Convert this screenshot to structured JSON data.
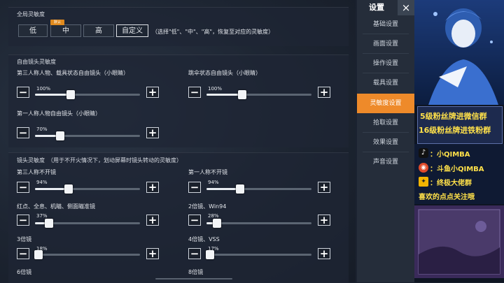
{
  "sensitivity": {
    "title": "全局灵敏度",
    "options": [
      "低",
      "中",
      "高",
      "自定义"
    ],
    "default_tag": "默认",
    "active_option": "自定义",
    "hint": "（选择\"低\"、\"中\"、\"高\"，恢复至对应的灵敏度）"
  },
  "free_camera": {
    "title": "自由镜头灵敏度",
    "sliders": [
      {
        "label": "第三人称人物、载具状态自由镜头（小眼睛）",
        "percent": "100%",
        "value": 100
      },
      {
        "label": "跳伞状态自由镜头（小眼睛）",
        "percent": "100%",
        "value": 100
      },
      {
        "label": "第一人称人物自由镜头（小眼睛）",
        "percent": "70%",
        "value": 70
      }
    ]
  },
  "lens": {
    "title": "镜头灵敏度　（用于不开火情况下，划动屏幕时镜头转动的灵敏度）",
    "sliders": [
      {
        "label": "第三人称不开镜",
        "percent": "94%",
        "value": 94
      },
      {
        "label": "第一人称不开镜",
        "percent": "94%",
        "value": 94
      },
      {
        "label": "红点、全息、机瞄、侧面瞄准镜",
        "percent": "37%",
        "value": 37
      },
      {
        "label": "2倍镜、Win94",
        "percent": "28%",
        "value": 28
      },
      {
        "label": "3倍镜",
        "percent": "18%",
        "value": 18
      },
      {
        "label": "4倍镜、VSS",
        "percent": "17%",
        "value": 17
      }
    ],
    "more_labels": [
      "6倍镜",
      "8倍镜"
    ]
  },
  "sidebar": {
    "title": "设置",
    "close": "×",
    "items": [
      "基础设置",
      "画面设置",
      "操作设置",
      "载具设置",
      "灵敏度设置",
      "拾取设置",
      "效果设置",
      "声音设置"
    ],
    "active_index": 4
  },
  "banner": {
    "promo_lines": [
      "5级粉丝牌进微信群",
      "16级粉丝牌进铁粉群"
    ],
    "social": [
      {
        "icon": "tiktok-icon",
        "text": "：小QIMBA"
      },
      {
        "icon": "weibo-icon",
        "text": "：斗鱼小QIMBA"
      },
      {
        "icon": "group-icon",
        "text": "：终极大佬群"
      }
    ],
    "tagline": "喜欢的点点关注哦"
  },
  "colors": {
    "accent": "#ee8a2a",
    "tag": "#e08a1e",
    "promo_yellow": "#ffe14a"
  }
}
